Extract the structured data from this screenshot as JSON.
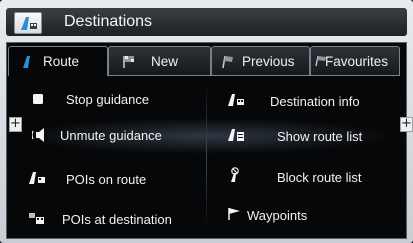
{
  "header": {
    "title": "Destinations",
    "icon": "navigation-map-icon"
  },
  "tabs": [
    {
      "label": "Route",
      "icon": "route-road-icon",
      "active": true
    },
    {
      "label": "New",
      "icon": "new-flag-icon",
      "active": false
    },
    {
      "label": "Previous",
      "icon": "previous-flag-icon",
      "active": false
    },
    {
      "label": "Favourites",
      "icon": "favourites-flag-icon",
      "active": false
    }
  ],
  "left_items": [
    {
      "label": "Stop guidance",
      "icon": "stop-square-icon"
    },
    {
      "label": "Unmute guidance",
      "icon": "speaker-icon"
    },
    {
      "label": "POIs on route",
      "icon": "poi-road-icon"
    },
    {
      "label": "POIs at destination",
      "icon": "poi-destination-icon"
    }
  ],
  "right_items": [
    {
      "label": "Destination info",
      "icon": "destination-info-icon"
    },
    {
      "label": "Show route list",
      "icon": "route-list-icon"
    },
    {
      "label": "Block route list",
      "icon": "block-route-icon"
    },
    {
      "label": "Waypoints",
      "icon": "waypoint-flag-icon"
    }
  ],
  "side_controls": {
    "left": "+",
    "right": "+"
  },
  "colors": {
    "accent_blue": "#2a8fd8",
    "background": "#060708",
    "frame": "#d6dade"
  }
}
